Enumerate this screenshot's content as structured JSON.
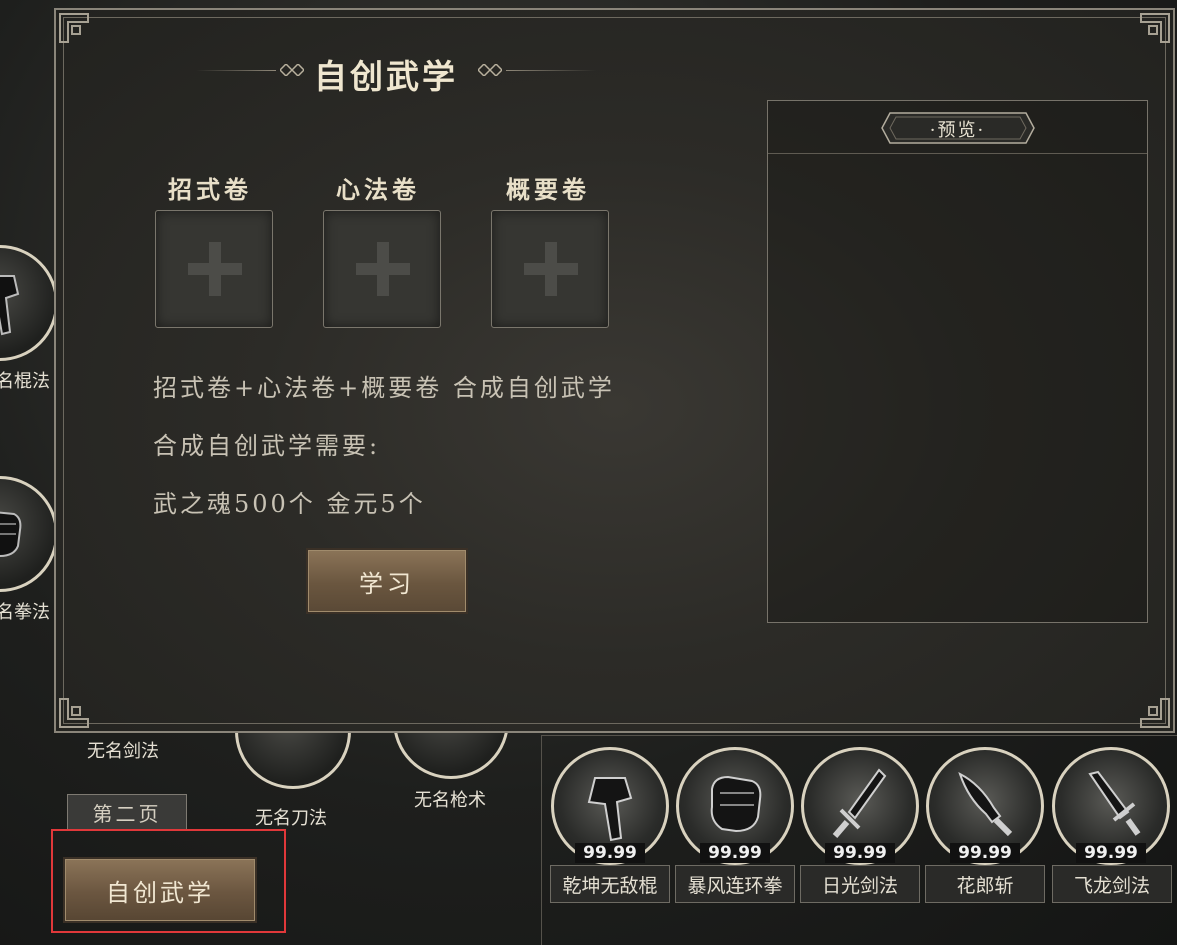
{
  "dialog": {
    "title": "自创武学",
    "slots": [
      {
        "label": "招式卷"
      },
      {
        "label": "心法卷"
      },
      {
        "label": "概要卷"
      }
    ],
    "formula": "招式卷+心法卷+概要卷 合成自创武学",
    "requirement_title": "合成自创武学需要:",
    "requirement_cost": "武之魂500个 金元5个",
    "learn_label": "学习",
    "preview_title": "·预览·"
  },
  "background_skills": [
    {
      "label": "名棍法",
      "icon": "axe-icon"
    },
    {
      "label": "名拳法",
      "icon": "fist-icon"
    },
    {
      "label": "无名剑法",
      "icon": "sword-icon"
    },
    {
      "label": "无名刀法",
      "icon": "blade-icon"
    },
    {
      "label": "无名枪术",
      "icon": "spear-icon"
    }
  ],
  "bottom": {
    "page_label": "第二页",
    "create_label": "自创武学",
    "skills": [
      {
        "name": "乾坤无敌棍",
        "count": "99.99",
        "icon": "axe-icon"
      },
      {
        "name": "暴风连环拳",
        "count": "99.99",
        "icon": "fist-icon"
      },
      {
        "name": "日光剑法",
        "count": "99.99",
        "icon": "sword-icon"
      },
      {
        "name": "花郎斩",
        "count": "99.99",
        "icon": "blade-icon"
      },
      {
        "name": "飞龙剑法",
        "count": "99.99",
        "icon": "dagger-icon"
      }
    ]
  },
  "colors": {
    "highlight": "#e0383a",
    "button_bronze": "#6a563f",
    "panel_border": "#8a857a"
  }
}
